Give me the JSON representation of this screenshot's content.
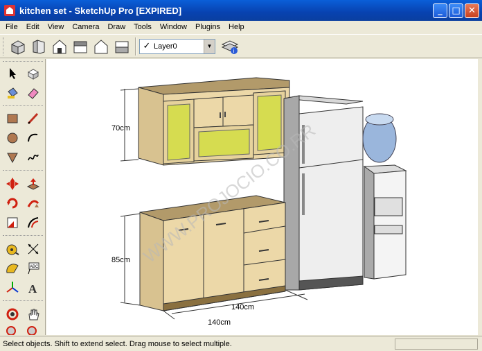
{
  "window": {
    "title": "kitchen set - SketchUp Pro [EXPIRED]",
    "minimize": "_",
    "maximize": "□",
    "close": "✕"
  },
  "menu": [
    "File",
    "Edit",
    "View",
    "Camera",
    "Draw",
    "Tools",
    "Window",
    "Plugins",
    "Help"
  ],
  "toolbar": {
    "layer": "Layer0",
    "layer_check": "✓"
  },
  "viewport": {
    "dim_upper_height": "70cm",
    "dim_lower_height": "85cm",
    "dim_depth": "140cm",
    "dim_width": "140cm",
    "watermark": "WWW.PROJOCIO.CO.RR"
  },
  "status": {
    "text": "Select objects. Shift to extend select. Drag mouse to select multiple."
  }
}
